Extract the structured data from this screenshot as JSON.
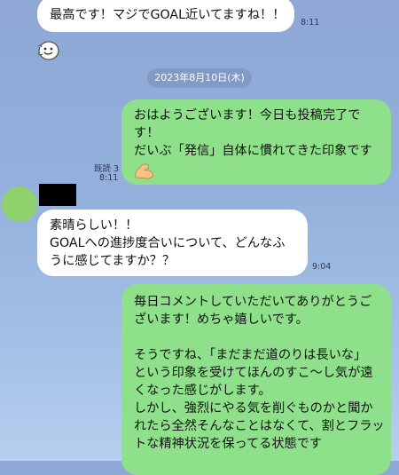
{
  "messages": {
    "msg1": {
      "lines": [
        "最高です！マジでGOAL近いてますね！！"
      ],
      "time": "8:11"
    },
    "date_separator": "2023年8月10日(木)",
    "msg2": {
      "lines": [
        "おはようございます！今日も投稿完了で",
        "す！",
        "だいぶ「発信」自体に慣れてきた印象です"
      ],
      "read": "既読 3",
      "time": "8:11",
      "emoji_icon": "flexed-biceps-icon"
    },
    "msg3": {
      "lines": [
        "素晴らしい！！",
        "GOALへの進捗度合いについて、どんなふ",
        "うに感じてますか？？"
      ],
      "time": "9:04"
    },
    "msg4": {
      "para1": [
        "毎日コメントしていただいてありがとうご",
        "ざいます！めちゃ嬉しいです。"
      ],
      "para2": [
        "そうですね、「まだまだ道のりは長いな」",
        "という印象を受けてほんのすこ〜し気が遠",
        "くなった感じがします。",
        "しかし、強烈にやる気を削ぐものかと聞か",
        "れたら全然そんなことはなくて、割とフラッ",
        "トな精神状況を保ってる状態です"
      ]
    }
  },
  "sender": {
    "avatar_color": "#8fd16c",
    "name_redacted": true
  },
  "icons": {
    "sticker": "smiling-face-sticker-icon"
  },
  "colors": {
    "incoming_bubble": "#ffffff",
    "outgoing_bubble": "#8ee08a",
    "background": "#93b0dc"
  }
}
